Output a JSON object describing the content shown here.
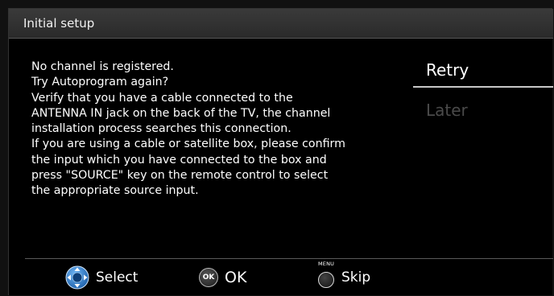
{
  "dialog": {
    "title": "Initial setup",
    "message_lines": [
      "No channel is registered.",
      "Try Autoprogram again?",
      "Verify that you have a cable connected to the",
      "ANTENNA IN jack on the back of the TV, the channel",
      "installation process searches this connection.",
      "If you are using a cable or satellite box, please confirm",
      "the input which you have connected to  the box and",
      "press \"SOURCE\" key on the remote control to select",
      "the appropriate source input."
    ],
    "options": [
      {
        "label": "Retry",
        "state": "selected"
      },
      {
        "label": "Later",
        "state": "disabled"
      }
    ]
  },
  "footer": {
    "select_label": "Select",
    "ok_button_text": "OK",
    "ok_label": "OK",
    "menu_button_text": "MENU",
    "skip_label": "Skip"
  },
  "icons": {
    "select": "dpad-icon",
    "ok": "ok-button-icon",
    "skip": "menu-button-icon"
  },
  "colors": {
    "background": "#000000",
    "titlebar": "#333333",
    "text": "#ffffff",
    "disabled_text": "#4a4a4a",
    "selection_underline": "#c8c8c8",
    "dpad_blue": "#2a7fd4"
  }
}
